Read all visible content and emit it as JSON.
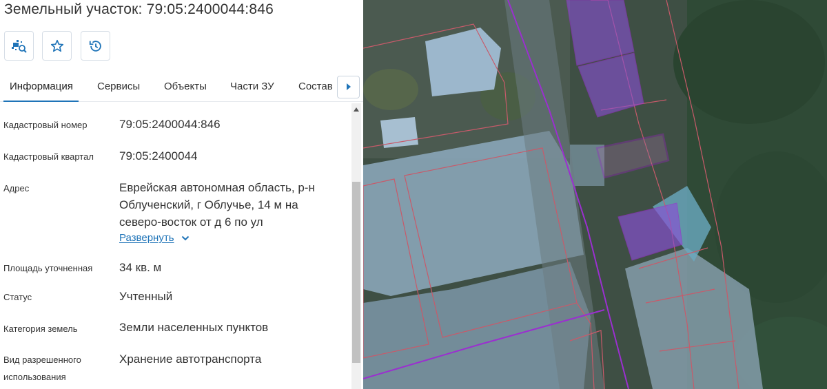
{
  "header": {
    "title": "Земельный участок: 79:05:2400044:846"
  },
  "actions": [
    {
      "name": "show-on-map",
      "icon": "locate-parcel-icon"
    },
    {
      "name": "favorite",
      "icon": "star-icon"
    },
    {
      "name": "history",
      "icon": "history-icon"
    }
  ],
  "tabs": [
    {
      "label": "Информация",
      "active": true
    },
    {
      "label": "Сервисы"
    },
    {
      "label": "Объекты"
    },
    {
      "label": "Части ЗУ"
    },
    {
      "label": "Состав"
    }
  ],
  "info": {
    "cadastral_number": {
      "label": "Кадастровый номер",
      "value": "79:05:2400044:846"
    },
    "cadastral_block": {
      "label": "Кадастровый квартал",
      "value": "79:05:2400044"
    },
    "address": {
      "label": "Адрес",
      "value": "Еврейская автономная область, р-н Облученский, г Облучье, 14 м на северо-восток от д 6 по ул",
      "expand_label": "Развернуть"
    },
    "area": {
      "label": "Площадь уточненная",
      "value": "34 кв. м"
    },
    "status": {
      "label": "Статус",
      "value": "Учтенный"
    },
    "land_category": {
      "label": "Категория земель",
      "value": "Земли населенных пунктов"
    },
    "permitted_use": {
      "label_line1": "Вид разрешенного",
      "label_line2": "использования",
      "value": "Хранение автотранспорта"
    }
  },
  "colors": {
    "accent": "#1f74b8",
    "parcel_highlight": "#9b2fd0",
    "parcel_fill": "#8a4fd6",
    "boundary": "#c85a6a"
  }
}
